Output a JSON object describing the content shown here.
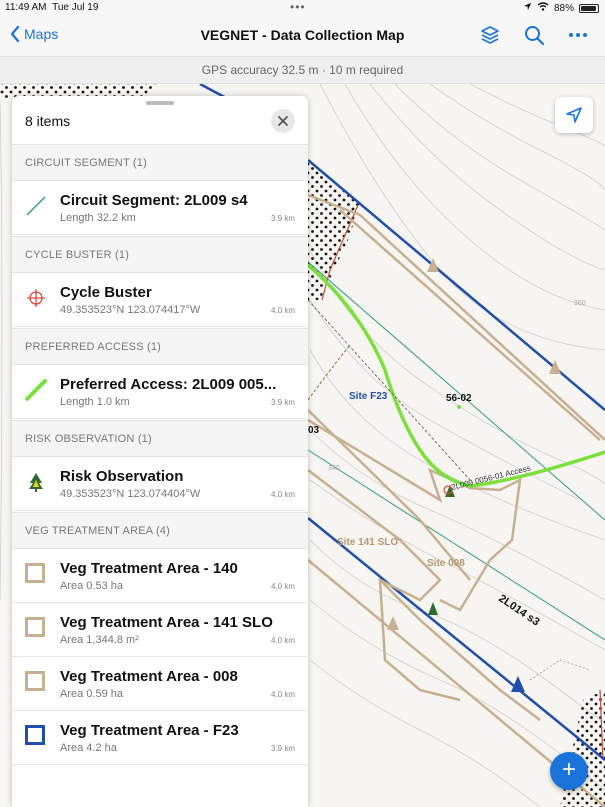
{
  "status_bar": {
    "time": "11:49 AM",
    "date": "Tue Jul 19",
    "battery": "88%"
  },
  "nav": {
    "back_label": "Maps",
    "title": "VEGNET - Data Collection Map",
    "icons": [
      "layers-icon",
      "search-icon",
      "more-icon"
    ]
  },
  "gps": {
    "text": "GPS accuracy 32.5 m  ·  10 m required"
  },
  "panel": {
    "count": "8 items",
    "sections": [
      {
        "label": "CIRCUIT SEGMENT (1)",
        "items": [
          {
            "title": "Circuit Segment: 2L009 s4",
            "subtitle": "Length 32.2 km",
            "distance": "3.9 km",
            "icon": "line-icon"
          }
        ]
      },
      {
        "label": "CYCLE BUSTER (1)",
        "items": [
          {
            "title": "Cycle Buster",
            "subtitle": "49.353523°N  123.074417°W",
            "distance": "4.0 km",
            "icon": "crosshair-icon"
          }
        ]
      },
      {
        "label": "PREFERRED ACCESS (1)",
        "items": [
          {
            "title": "Preferred Access: 2L009 005...",
            "subtitle": "Length 1.0 km",
            "distance": "3.9 km",
            "icon": "access-line-icon"
          }
        ]
      },
      {
        "label": "RISK OBSERVATION (1)",
        "items": [
          {
            "title": "Risk Observation",
            "subtitle": "49.353523°N  123.074404°W",
            "distance": "4.0 km",
            "icon": "hazard-tree-icon"
          }
        ]
      },
      {
        "label": "VEG TREATMENT AREA (4)",
        "items": [
          {
            "title": "Veg Treatment Area - 140",
            "subtitle": "Area 0.53 ha",
            "distance": "4.0 km",
            "icon": "tan-square-icon"
          },
          {
            "title": "Veg Treatment Area - 141 SLO",
            "subtitle": "Area 1,344.8 m²",
            "distance": "4.0 km",
            "icon": "tan-square-icon"
          },
          {
            "title": "Veg Treatment Area - 008",
            "subtitle": "Area 0.59 ha",
            "distance": "4.0 km",
            "icon": "tan-square-icon"
          },
          {
            "title": "Veg Treatment Area - F23",
            "subtitle": "Area 4.2 ha",
            "distance": "3.9 km",
            "icon": "blue-square-icon"
          }
        ]
      }
    ]
  },
  "map": {
    "labels": {
      "site_f23": "Site F23",
      "site_141": "Site 141 SLO",
      "site_008": "Site 008",
      "pole": "56-02",
      "circuit": "2L014 s3",
      "access": "2L009 0056-01 Access",
      "contour_360": "360",
      "contour_340": "340",
      "partial": "03"
    }
  },
  "colors": {
    "accent": "#1a73d9",
    "tan": "#c7b08f",
    "blue_line": "#1f4fa8",
    "green_access": "#7be03c",
    "teal_line": "#2a9d7c"
  }
}
